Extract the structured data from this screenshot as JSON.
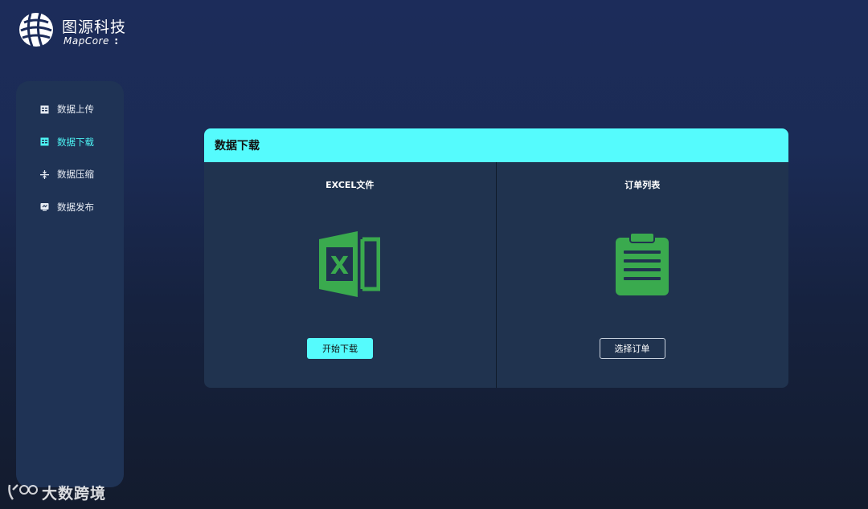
{
  "brand": {
    "name_cn": "图源科技",
    "name_en": "MapCore",
    "name_en_suffix": ":"
  },
  "sidebar": {
    "items": [
      {
        "label": "数据上传",
        "icon": "table-icon",
        "active": false
      },
      {
        "label": "数据下载",
        "icon": "table-icon",
        "active": true
      },
      {
        "label": "数据压缩",
        "icon": "compress-icon",
        "active": false
      },
      {
        "label": "数据发布",
        "icon": "publish-icon",
        "active": false
      }
    ]
  },
  "panel": {
    "title": "数据下载",
    "left": {
      "title": "EXCEL文件",
      "icon": "excel-icon",
      "button_label": "开始下载"
    },
    "right": {
      "title": "订单列表",
      "icon": "clipboard-icon",
      "button_label": "选择订单"
    }
  },
  "watermark": {
    "text": "大数跨境"
  },
  "colors": {
    "accent": "#55fbfd",
    "icon_green": "#3aaa4e",
    "sidebar_bg": "#1f3355",
    "panel_bg": "#20334f"
  }
}
